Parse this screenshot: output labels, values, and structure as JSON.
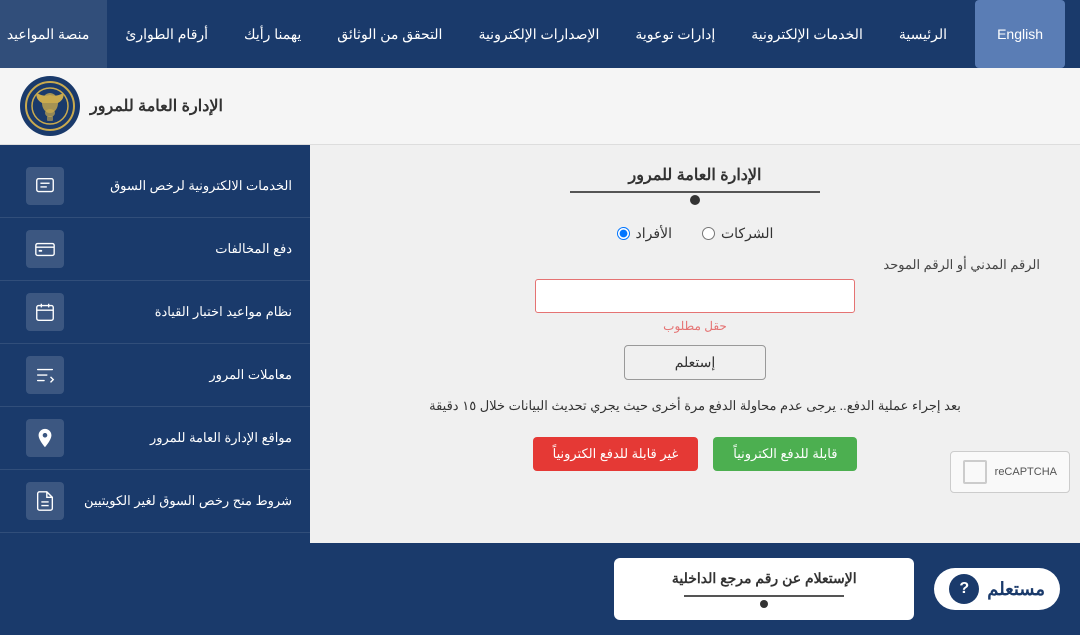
{
  "nav": {
    "items": [
      {
        "label": "الرئيسية",
        "active": false
      },
      {
        "label": "الخدمات الإلكترونية",
        "active": false
      },
      {
        "label": "إدارات توعوية",
        "active": false
      },
      {
        "label": "الإصدارات الإلكترونية",
        "active": false
      },
      {
        "label": "التحقق من الوثائق",
        "active": false
      },
      {
        "label": "يهمنا رأيك",
        "active": false
      },
      {
        "label": "أرقام الطوارئ",
        "active": false
      },
      {
        "label": "منصة المواعيد",
        "active": false
      }
    ],
    "english_btn": "English"
  },
  "header": {
    "logo_text": "الإدارة العامة للمرور"
  },
  "form": {
    "title": "الإدارة العامة للمرور",
    "radio_individuals": "الأفراد",
    "radio_companies": "الشركات",
    "field_label": "الرقم المدني أو الرقم الموحد",
    "required_text": "حقل مطلوب",
    "inquiry_btn": "إستعلم",
    "info_text": "بعد إجراء عملية الدفع.. يرجى عدم محاولة الدفع مرة أخرى حيث يجري تحديث البيانات خلال ١٥ دقيقة",
    "btn_green_label": "قابلة للدفع الكترونياً",
    "btn_red_label": "غير قابلة للدفع الكترونياً"
  },
  "sidebar": {
    "items": [
      {
        "text": "الخدمات الالكترونية لرخص السوق",
        "icon": "license-icon"
      },
      {
        "text": "دفع المخالفات",
        "icon": "payment-icon"
      },
      {
        "text": "نظام مواعيد اختبار القيادة",
        "icon": "calendar-icon"
      },
      {
        "text": "معاملات المرور",
        "icon": "transactions-icon"
      },
      {
        "text": "مواقع الإدارة العامة للمرور",
        "icon": "location-icon"
      },
      {
        "text": "شروط منح رخص السوق لغير الكويتيين",
        "icon": "pdf-icon"
      }
    ]
  },
  "bottom": {
    "mustalam_text": "مستعلم",
    "bottom_card_title": "الإستعلام عن رقم مرجع الداخلية"
  },
  "recaptcha": {
    "label": "reCAPTCHA"
  }
}
